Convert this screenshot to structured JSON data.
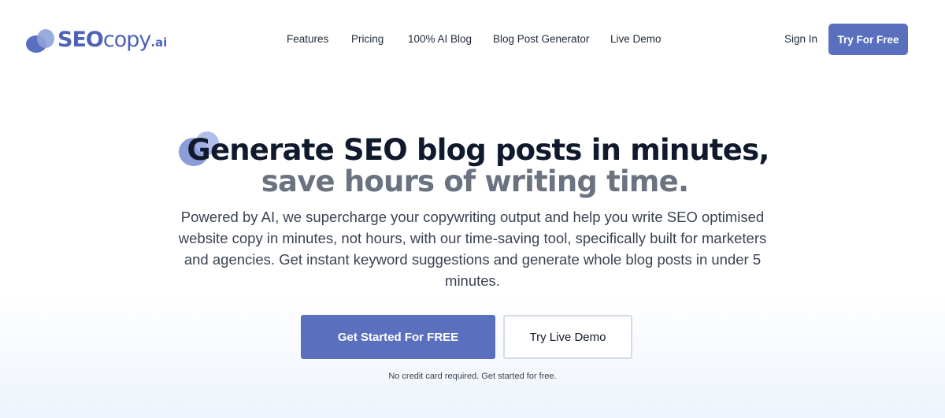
{
  "header": {
    "logo": {
      "seo": "SEO",
      "copy": "copy",
      "ai": ".ai"
    },
    "nav": [
      {
        "label": "Features"
      },
      {
        "label": "Pricing"
      },
      {
        "label": "100% AI Blog"
      },
      {
        "label": "Blog Post Generator"
      },
      {
        "label": "Live Demo"
      }
    ],
    "signin_label": "Sign In",
    "cta_label": "Try For Free"
  },
  "hero": {
    "headline_line1": "Generate SEO blog posts in minutes,",
    "headline_line2": "save hours of writing time.",
    "subtitle": "Powered by AI, we supercharge your copywriting output and help you write SEO optimised website copy in minutes, not hours, with our time-saving tool, specifically built for marketers and agencies. Get instant keyword suggestions and generate whole blog posts in under 5 minutes.",
    "primary_button": "Get Started For FREE",
    "secondary_button": "Try Live Demo",
    "note": "No credit card required. Get started for free."
  },
  "colors": {
    "brand": "#5a70bf",
    "headline": "#111a2c",
    "headline_muted": "#6b7280"
  }
}
